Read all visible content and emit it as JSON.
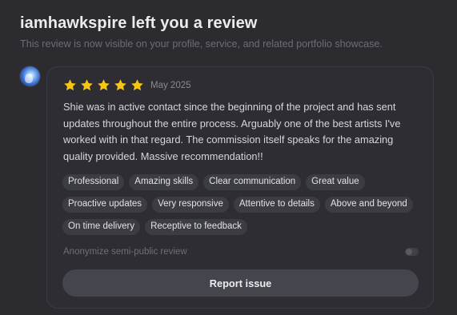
{
  "header": {
    "title": "iamhawkspire left you a review",
    "subtitle": "This review is now visible on your profile, service, and related portfolio showcase."
  },
  "review": {
    "rating": 5,
    "rating_max": 5,
    "star_color": "#f5c518",
    "date": "May 2025",
    "text": "Shie was in active contact since the beginning of the project and has sent updates throughout the entire process. Arguably one of the best artists I've worked with in that regard. The commission itself speaks for the amazing quality provided. Massive recommendation!!",
    "tags": [
      "Professional",
      "Amazing skills",
      "Clear communication",
      "Great value",
      "Proactive updates",
      "Very responsive",
      "Attentive to details",
      "Above and beyond",
      "On time delivery",
      "Receptive to feedback"
    ]
  },
  "anonymize": {
    "label": "Anonymize semi-public review",
    "enabled": false
  },
  "actions": {
    "report_label": "Report issue"
  }
}
